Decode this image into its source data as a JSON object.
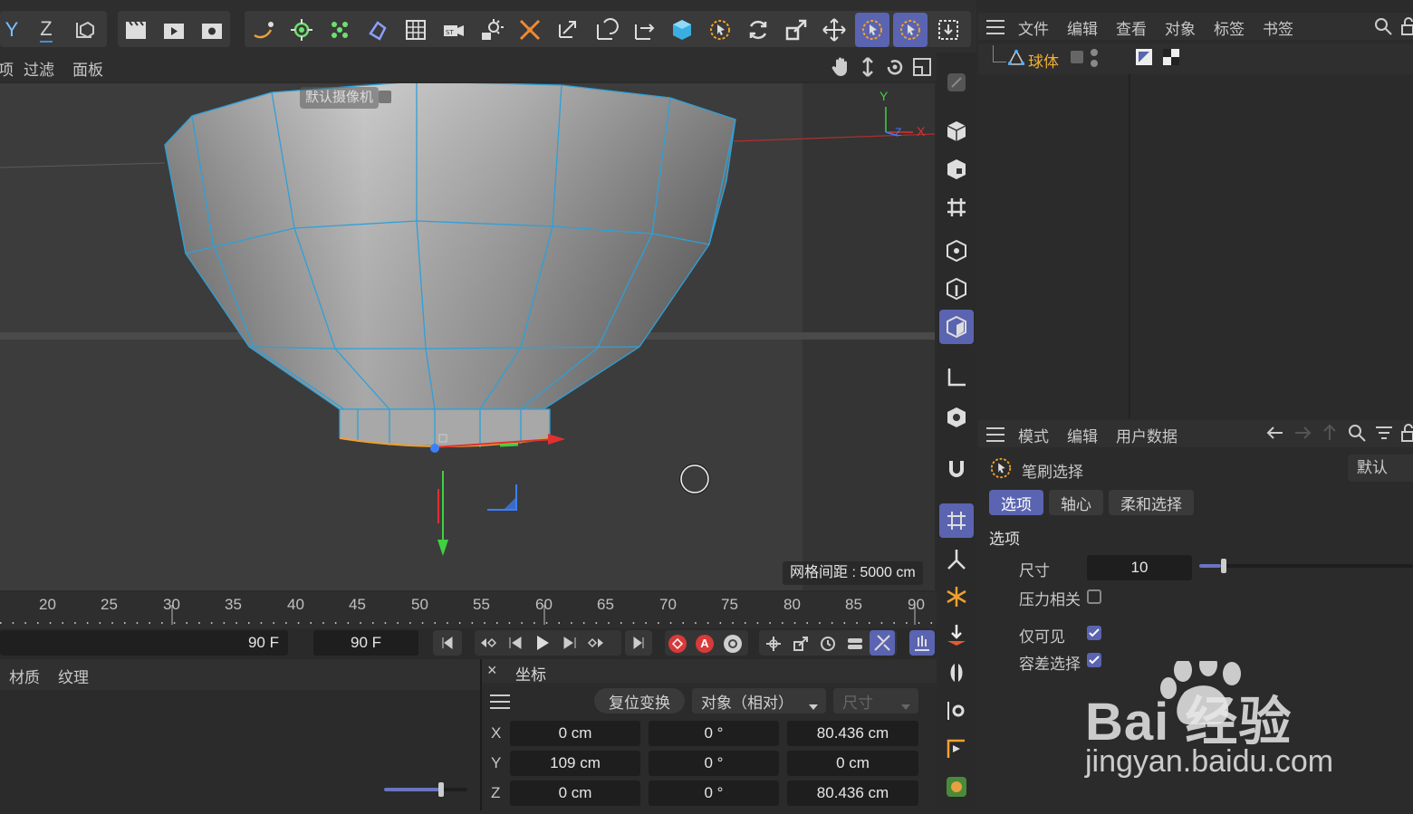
{
  "toolbar": {
    "axis_y": "Y",
    "axis_z": "Z"
  },
  "viewport_menu": {
    "item_partial": "项",
    "filter": "过滤",
    "panel": "面板"
  },
  "viewport": {
    "camera_label": "默认摄像机",
    "grid_spacing": "网格间距 : 5000 cm",
    "axis_y": "Y",
    "axis_x": "X",
    "axis_z": "Z"
  },
  "object_manager": {
    "menu": [
      "文件",
      "编辑",
      "查看",
      "对象",
      "标签",
      "书签"
    ],
    "objects": [
      {
        "name": "球体"
      }
    ]
  },
  "attributes": {
    "menu": [
      "模式",
      "编辑",
      "用户数据"
    ],
    "tool_name": "笔刷选择",
    "preset": "默认",
    "tabs": [
      "选项",
      "轴心",
      "柔和选择"
    ],
    "section": "选项",
    "size_label": "尺寸",
    "size_value": "10",
    "size_fraction": 0.1,
    "pressure_label": "压力相关",
    "pressure_checked": false,
    "visible_only_label": "仅可见",
    "visible_only_checked": true,
    "tolerance_label": "容差选择",
    "tolerance_checked": true
  },
  "timeline": {
    "ticks": [
      "20",
      "25",
      "30",
      "35",
      "40",
      "45",
      "50",
      "55",
      "60",
      "65",
      "70",
      "75",
      "80",
      "85",
      "90"
    ],
    "end_frame_left": "90 F",
    "end_frame": "90 F"
  },
  "material_panel": {
    "tab_material": "材质",
    "tab_texture": "纹理"
  },
  "coordinates": {
    "title": "坐标",
    "close": "×",
    "reset_transform": "复位变换",
    "mode": "对象（相对）",
    "size_mode": "尺寸",
    "rows": [
      {
        "axis": "X",
        "pos": "0 cm",
        "rot": "0 °",
        "size": "80.436 cm"
      },
      {
        "axis": "Y",
        "pos": "109 cm",
        "rot": "0 °",
        "size": "0 cm"
      },
      {
        "axis": "Z",
        "pos": "0 cm",
        "rot": "0 °",
        "size": "80.436 cm"
      }
    ]
  },
  "watermark": {
    "text": "Bai 经验",
    "url": "jingyan.baidu.com"
  },
  "colors": {
    "accent": "#5a64b0",
    "selection_edge": "#2ea0d8",
    "object_name": "#f0b030"
  }
}
